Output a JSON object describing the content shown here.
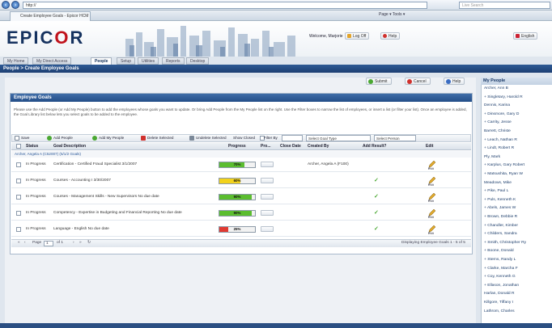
{
  "browser": {
    "back_icon": "back-arrow-icon",
    "forward_icon": "forward-arrow-icon",
    "url": "http://",
    "search_placeholder": "Live Search",
    "tab_title": "Create Employee Goals - Epicor HCM",
    "toolbar_items": "Page ▾   Tools ▾"
  },
  "header": {
    "logo_part1": "EPIC",
    "logo_o": "O",
    "logo_part2": "R",
    "welcome": "Welcome, Marjorie",
    "logoff_label": "Log Off",
    "help_label": "Help",
    "english_label": "English"
  },
  "nav": {
    "tabs": [
      "My Home",
      "My Direct Access",
      "People",
      "Setup",
      "Utilities",
      "Reports",
      "Desktop"
    ],
    "active_index": 2
  },
  "breadcrumb": "People > Create Employee Goals",
  "actions": {
    "submit": "Submit",
    "cancel": "Cancel",
    "help": "Help"
  },
  "panel": {
    "title": "Employee Goals",
    "instructions": "Please use the Add People (or Add My People) button to add the employees whose goals you want to update. Or bring Add People from the My People list on the right. Use the Filter boxes to narrow the list of employees, or insert a list (or filter your list). Once an employee is added, the Goal Library list below lets you select goals to be added to the employee."
  },
  "toolbar": {
    "save": "Save",
    "add_people": "Add People",
    "add_my_people": "Add My People",
    "delete_selected": "Delete Selected",
    "undelete_selected": "Undelete Selected",
    "show_closed": "Show Closed",
    "filter_by": "Filter By",
    "goal_type": "Select Goal Type",
    "select_person": "Select Person"
  },
  "table": {
    "columns": [
      "Status",
      "Goal Description",
      "Progress",
      "Pro...",
      "Close Date",
      "Created By",
      "Add Result?",
      "Edit"
    ],
    "group_label": "Archer, Angela A (C52007) (5/1/2 Goals)",
    "rows": [
      {
        "status": "In Progress",
        "description": "Certification - Certified Fraud Specialist  3/1/2007",
        "progress": 70,
        "bar_color": "#5bbd2f",
        "pct_label": "70%",
        "created_by": "Archer, Angela A (F100)",
        "add_result": false
      },
      {
        "status": "In Progress",
        "description": "Courses - Accounting I  3/30/2007",
        "progress": 60,
        "bar_color": "#f2d21c",
        "pct_label": "60%",
        "created_by": "",
        "add_result": true
      },
      {
        "status": "In Progress",
        "description": "Courses - Management Skills - New Supervisors  No due date",
        "progress": 90,
        "bar_color": "#5bbd2f",
        "pct_label": "90%",
        "created_by": "",
        "add_result": true
      },
      {
        "status": "In Progress",
        "description": "Competency - Expertise in Budgeting and Financial Reporting  No due date",
        "progress": 90,
        "bar_color": "#5bbd2f",
        "pct_label": "90%",
        "created_by": "",
        "add_result": true
      },
      {
        "status": "In Progress",
        "description": "Language - English  No due date",
        "progress": 25,
        "bar_color": "#e03a32",
        "pct_label": "25%",
        "created_by": "",
        "add_result": true
      }
    ],
    "edit_label": "Edit"
  },
  "pager": {
    "page_label": "Page",
    "page_value": "1",
    "of_label": "of 1",
    "summary": "Displaying Employee Goals 1 - 5 of 5"
  },
  "sidebar": {
    "title": "My People",
    "people": [
      "Archer, Ann B",
      "+ Singletary, Harold R",
      "   Dennis, Karina",
      "   + Dinsmore, Gary D",
      "      + Carrity, Jesse",
      "         Barrett, Christe",
      "      + Leach, Nathan R",
      "      + Lindt, Robert R",
      "         Ply, Mark",
      "+ Karplus, Gary Robert",
      "+ Matsushita, Ryan W",
      "   Meadows, Mike",
      "+ Pike, Paul L",
      "+ Puls, Kenneth K",
      "   + Abels, James W",
      "   + Brown, Debbie R",
      "   + Chandler, Kimber",
      "   + Childers, Sandra",
      "+ Smith, Christopher Ry",
      "   + Boone, Donald",
      "+ Sterns, Randy L",
      "   + Clarke, Marcha F",
      "   + Coy, Kenneth G",
      "   + Ellason, Jonathan",
      "      Harlan, Donald R",
      "      Killgore, Tiffany I",
      "      Lathrom, Charles"
    ]
  }
}
